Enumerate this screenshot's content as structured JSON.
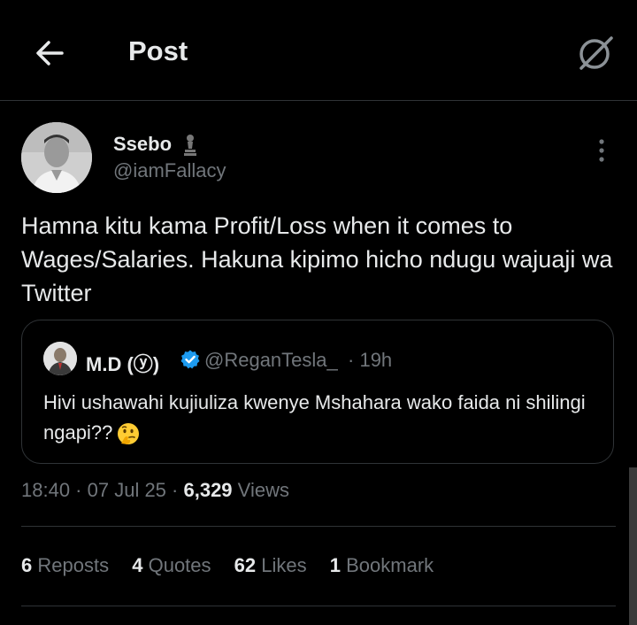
{
  "header": {
    "title": "Post",
    "back_icon": "back-arrow-icon",
    "action_icon": "grok-icon"
  },
  "post": {
    "author_name": "Ssebo",
    "author_handle": "@iamFallacy",
    "text": "Hamna kitu kama Profit/Loss when it comes to Wages/Salaries. Hakuna kipimo hicho ndugu wajuaji wa Twitter",
    "time": "18:40",
    "date": "07 Jul 25",
    "views_count": "6,329",
    "views_label": "Views"
  },
  "quoted_post": {
    "author_name": "M.D (ⓨ)",
    "author_handle": "@ReganTesla_",
    "time_ago": "19h",
    "text": "Hivi ushawahi kujiuliza kwenye Mshahara wako faida ni shilingi ngapi??",
    "verified_color": "#1d9bf0"
  },
  "stats": {
    "reposts_count": "6",
    "reposts_label": "Reposts",
    "quotes_count": "4",
    "quotes_label": "Quotes",
    "likes_count": "62",
    "likes_label": "Likes",
    "bookmarks_count": "1",
    "bookmarks_label": "Bookmark"
  },
  "colors": {
    "background": "#000000",
    "text": "#e7e9ea",
    "muted": "#71767b",
    "border": "#2f3336"
  }
}
